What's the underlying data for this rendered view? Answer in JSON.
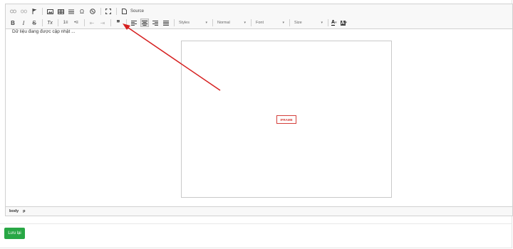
{
  "toolbar": {
    "row1": {
      "link_icon": "link-icon",
      "unlink_icon": "unlink-icon",
      "anchor_icon": "flag-icon",
      "image_icon": "image-icon",
      "table_icon": "table-icon",
      "hr_icon": "horizontal-rule-icon",
      "special_char_glyph": "Ω",
      "iframe_icon": "globe-icon",
      "maximize_icon": "maximize-icon",
      "source_label": "Source"
    },
    "row2": {
      "bold": "B",
      "italic": "I",
      "strike": "S",
      "remove_format": "Tx",
      "ordered_list": "1≡",
      "bullet_list": "•≡",
      "outdent": "⇤",
      "indent": "⇥",
      "blockquote": "❞",
      "align_left": "≡",
      "align_center": "≡",
      "align_right": "≡",
      "align_justify": "≡",
      "styles_combo": "Styles",
      "format_combo": "Normal",
      "font_combo": "Font",
      "size_combo": "Size",
      "text_color": "A",
      "bg_color": "A"
    }
  },
  "content": {
    "loading_text": "Dữ liệu đang được cập nhật ...",
    "iframe_placeholder": "IFRAME"
  },
  "statusbar": {
    "path": [
      "body",
      "p"
    ]
  },
  "form": {
    "save_label": "Lưu lại"
  },
  "colors": {
    "save_button": "#28a745",
    "annotation_arrow": "#d62020",
    "iframe_placeholder_border": "#d43f3a"
  }
}
